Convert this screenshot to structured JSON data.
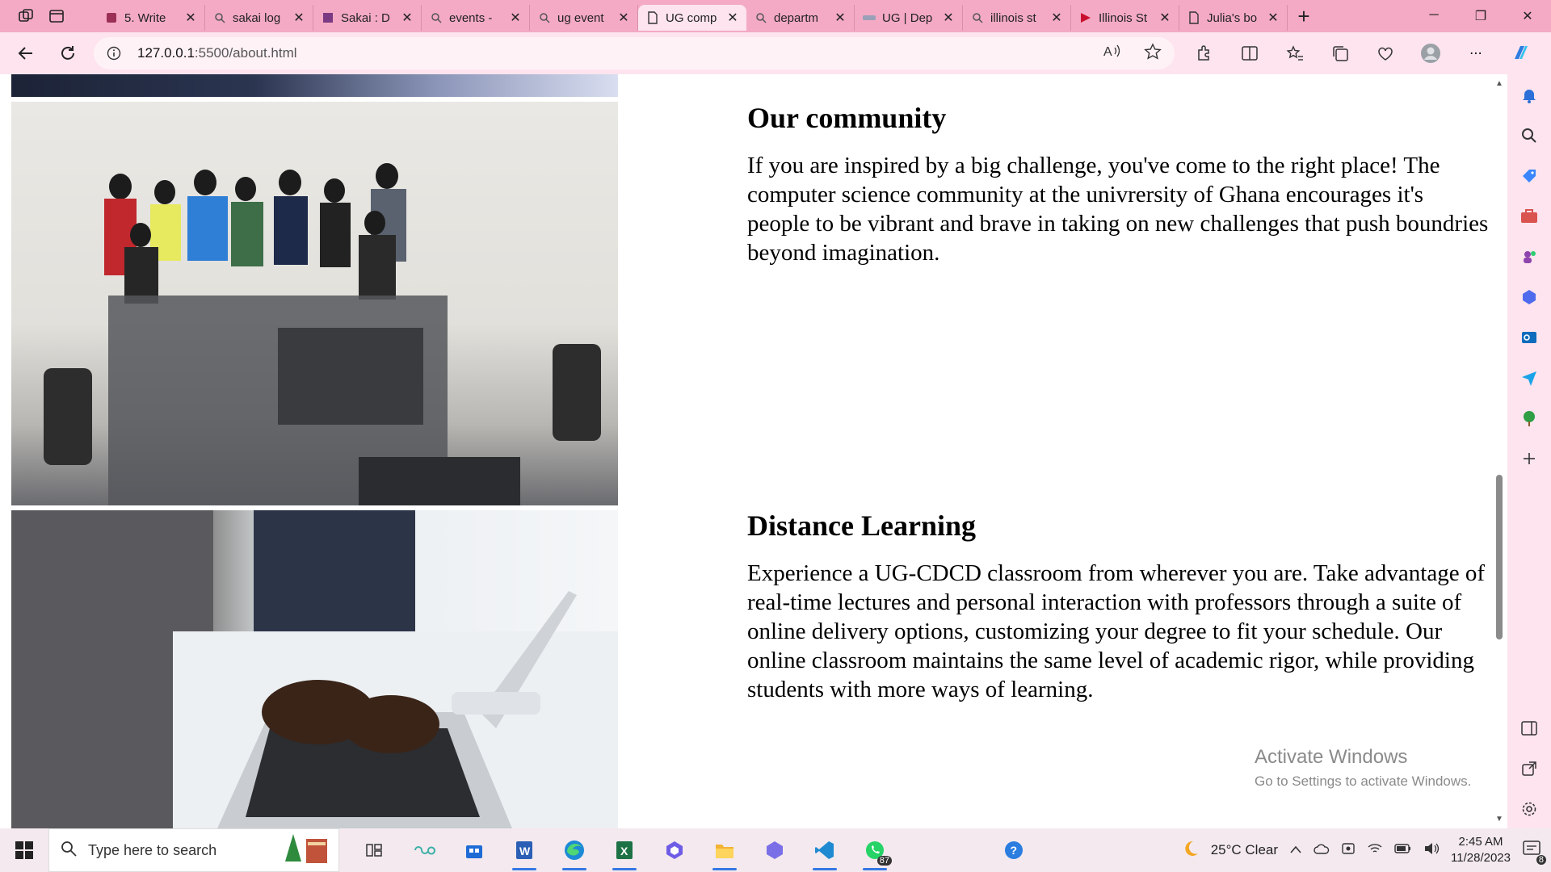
{
  "tabs": [
    {
      "title": "5. Write",
      "icon": "book-icon"
    },
    {
      "title": "sakai log",
      "icon": "search-icon"
    },
    {
      "title": "Sakai : D",
      "icon": "sakai-icon"
    },
    {
      "title": "events -",
      "icon": "search-icon"
    },
    {
      "title": "ug event",
      "icon": "search-icon"
    },
    {
      "title": "UG comp",
      "icon": "page-icon",
      "active": true
    },
    {
      "title": "departm",
      "icon": "search-icon"
    },
    {
      "title": "UG | Dep",
      "icon": "ug-icon"
    },
    {
      "title": "illinois st",
      "icon": "search-icon"
    },
    {
      "title": "Illinois St",
      "icon": "illinois-icon"
    },
    {
      "title": "Julia's bo",
      "icon": "page-icon"
    }
  ],
  "address": {
    "host": "127.0.0.1",
    "path": ":5500/about.html"
  },
  "page": {
    "section1": {
      "heading": "Our community",
      "body": "If you are inspired by a big challenge, you've come to the right place! The computer science community at the univrersity of Ghana encourages it's people to be vibrant and brave in taking on new challenges that push boundries beyond imagination."
    },
    "section2": {
      "heading": "Distance Learning",
      "body": "Experience a UG-CDCD classroom from wherever you are. Take advantage of real-time lectures and personal interaction with professors through a suite of online delivery options, customizing your degree to fit your schedule. Our online classroom maintains the same level of academic rigor, while providing students with more ways of learning."
    }
  },
  "watermark": {
    "line1": "Activate Windows",
    "line2": "Go to Settings to activate Windows."
  },
  "taskbar": {
    "search_placeholder": "Type here to search",
    "whatsapp_badge": "87",
    "weather": "25°C  Clear",
    "time": "2:45 AM",
    "date": "11/28/2023",
    "notifications": "8"
  },
  "colors": {
    "tabstrip": "#f4aac4",
    "toolbar": "#fde4ee",
    "accent": "#3578e5"
  }
}
